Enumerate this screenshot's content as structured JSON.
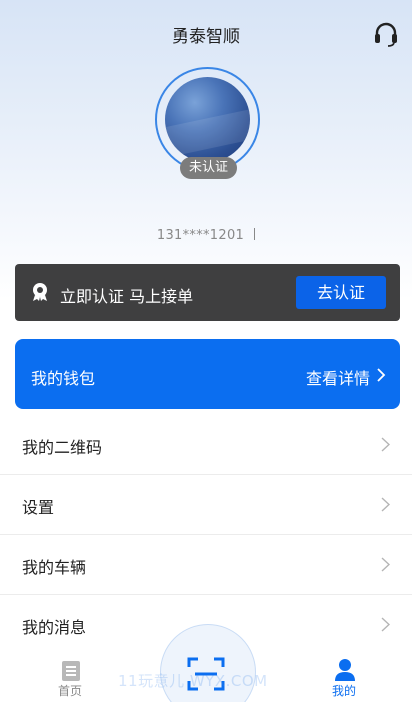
{
  "header": {
    "title": "勇泰智顺",
    "support_icon": "headset-icon"
  },
  "profile": {
    "status_badge": "未认证",
    "phone": "131****1201",
    "phone_suffix": "l"
  },
  "verify_banner": {
    "icon": "verify-badge-icon",
    "text": "立即认证 马上接单",
    "button_label": "去认证",
    "colors": {
      "background": "#3f3f40",
      "button": "#0b63e8"
    }
  },
  "wallet": {
    "title": "我的钱包",
    "detail_label": "查看详情",
    "color": "#0b6ef0"
  },
  "menu": {
    "items": [
      {
        "label": "我的二维码"
      },
      {
        "label": "设置"
      },
      {
        "label": "我的车辆"
      },
      {
        "label": "我的消息"
      }
    ]
  },
  "tabbar": {
    "home_label": "首页",
    "mine_label": "我的",
    "scan_icon": "scan-icon",
    "active_color": "#0b6ef0"
  },
  "watermark": "11玩意儿 WYX.COM"
}
